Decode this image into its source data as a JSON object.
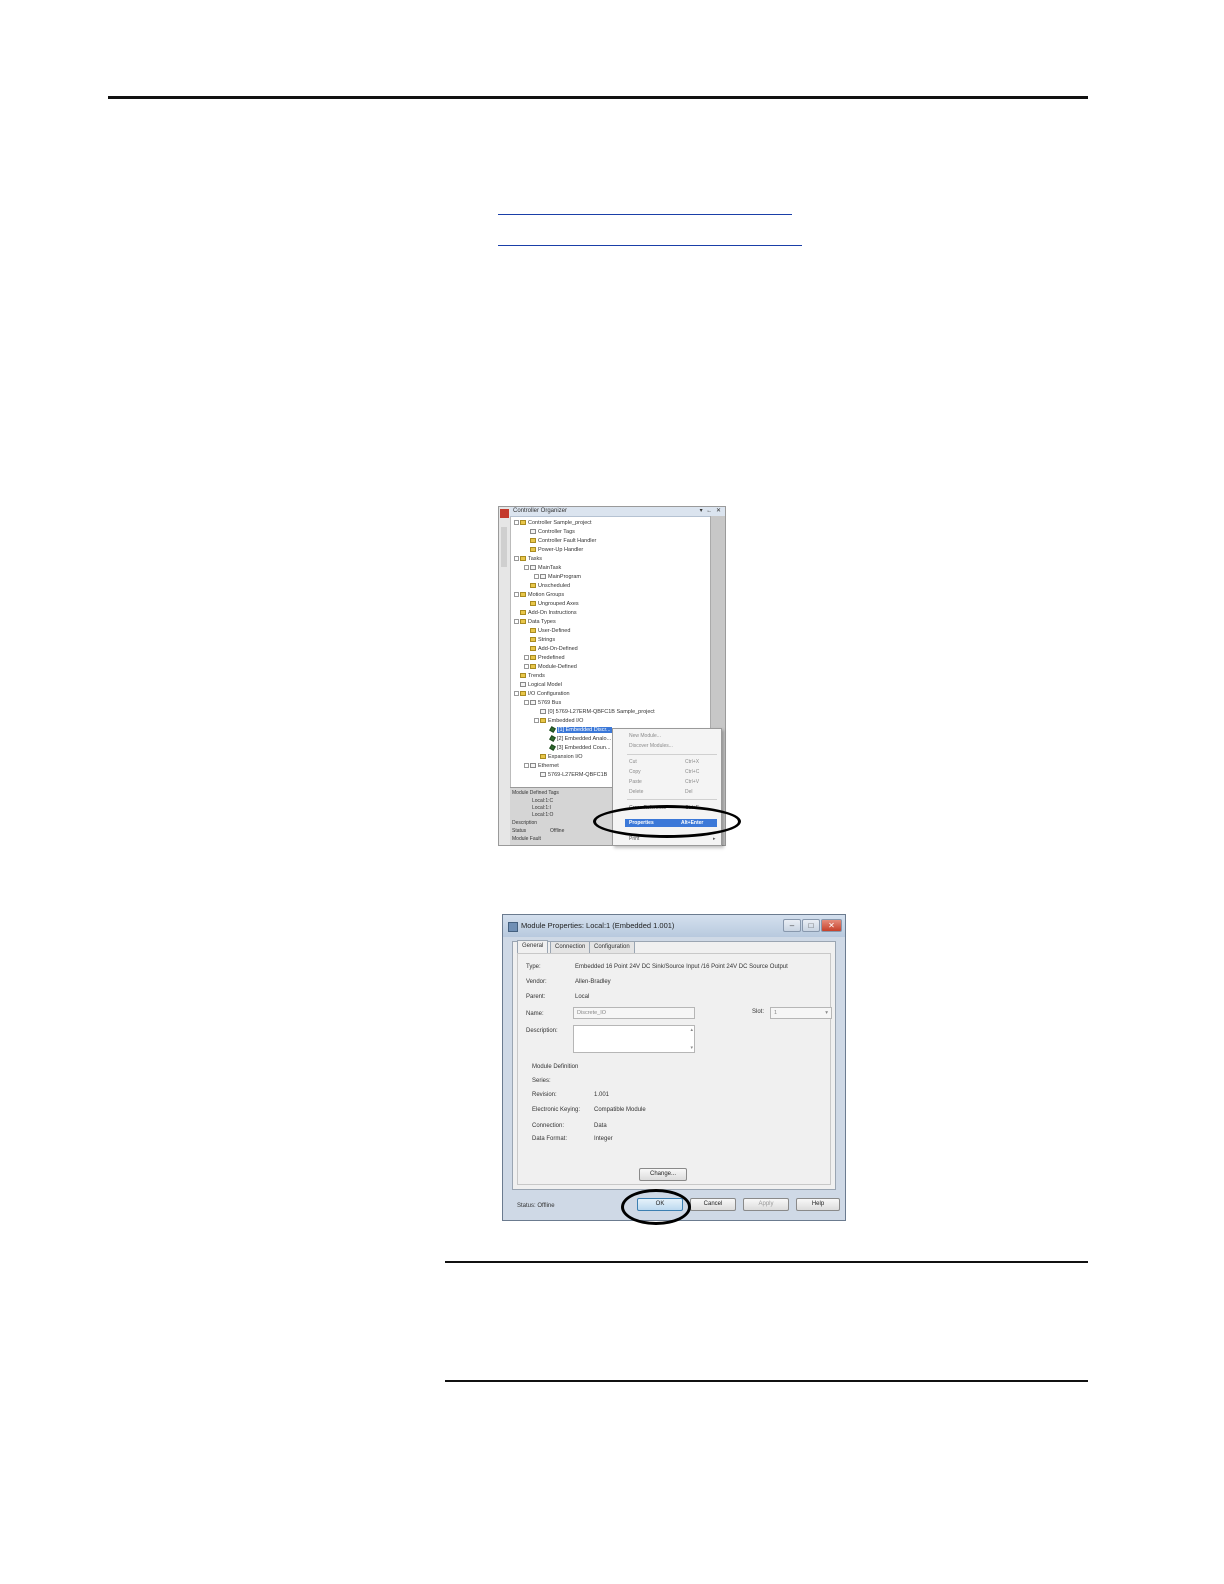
{
  "organizer": {
    "title": "Controller Organizer",
    "title_buttons": "▾ ← ✕",
    "tree": [
      {
        "label": "Controller Sample_project",
        "icon": "folder-icon",
        "expanded": true
      },
      {
        "label": "Controller Tags",
        "icon": "tags-icon"
      },
      {
        "label": "Controller Fault Handler",
        "icon": "folder-icon"
      },
      {
        "label": "Power-Up Handler",
        "icon": "folder-icon"
      },
      {
        "label": "Tasks",
        "icon": "folder-icon",
        "expanded": true
      },
      {
        "label": "MainTask",
        "icon": "task-icon",
        "expanded": true
      },
      {
        "label": "MainProgram",
        "icon": "program-icon"
      },
      {
        "label": "Unscheduled",
        "icon": "folder-icon"
      },
      {
        "label": "Motion Groups",
        "icon": "folder-icon",
        "expanded": true
      },
      {
        "label": "Ungrouped Axes",
        "icon": "folder-icon"
      },
      {
        "label": "Add-On Instructions",
        "icon": "folder-icon"
      },
      {
        "label": "Data Types",
        "icon": "folder-icon",
        "expanded": true
      },
      {
        "label": "User-Defined",
        "icon": "folder-icon"
      },
      {
        "label": "Strings",
        "icon": "folder-icon"
      },
      {
        "label": "Add-On-Defined",
        "icon": "folder-icon"
      },
      {
        "label": "Predefined",
        "icon": "folder-icon"
      },
      {
        "label": "Module-Defined",
        "icon": "folder-icon"
      },
      {
        "label": "Trends",
        "icon": "folder-icon"
      },
      {
        "label": "Logical Model",
        "icon": "model-icon"
      },
      {
        "label": "I/O Configuration",
        "icon": "folder-icon",
        "expanded": true
      },
      {
        "label": "5769 Bus",
        "icon": "bus-icon",
        "expanded": true
      },
      {
        "label": "[0] 5769-L27ERM-QBFC1B Sample_project",
        "icon": "controller-icon"
      },
      {
        "label": "Embedded I/O",
        "icon": "folder-icon",
        "expanded": true
      },
      {
        "label": "[1] Embedded Discr...",
        "icon": "module-icon",
        "selected": true
      },
      {
        "label": "[2] Embedded Analo...",
        "icon": "module-icon"
      },
      {
        "label": "[3] Embedded Coun...",
        "icon": "module-icon"
      },
      {
        "label": "Expansion I/O",
        "icon": "folder-icon"
      },
      {
        "label": "Ethernet",
        "icon": "network-icon",
        "expanded": true
      },
      {
        "label": "5769-L27ERM-QBFC1B",
        "icon": "controller-icon"
      }
    ],
    "bottom": {
      "header": "Module Defined Tags",
      "tags": [
        "Local:1:C",
        "Local:1:I",
        "Local:1:O"
      ],
      "description_label": "Description",
      "status_label": "Status",
      "status_value": "Offline",
      "module_fault_label": "Module Fault"
    }
  },
  "context_menu": {
    "items": [
      {
        "label": "New Module...",
        "shortcut": ""
      },
      {
        "label": "Discover Modules...",
        "shortcut": ""
      },
      {
        "label": "Cut",
        "shortcut": "Ctrl+X"
      },
      {
        "label": "Copy",
        "shortcut": "Ctrl+C"
      },
      {
        "label": "Paste",
        "shortcut": "Ctrl+V"
      },
      {
        "label": "Delete",
        "shortcut": "Del"
      },
      {
        "label": "Cross Reference",
        "shortcut": "Ctrl+E"
      },
      {
        "label": "Properties",
        "shortcut": "Alt+Enter"
      },
      {
        "label": "Print",
        "shortcut": "▸"
      }
    ]
  },
  "dialog": {
    "title": "Module Properties: Local:1 (Embedded 1.001)",
    "win_buttons": {
      "min": "–",
      "max": "□",
      "close": "✕"
    },
    "tabs": [
      "General",
      "Connection",
      "Configuration"
    ],
    "fields": {
      "type_label": "Type:",
      "type_value": "Embedded 16 Point 24V DC Sink/Source Input /16 Point 24V DC Source Output",
      "vendor_label": "Vendor:",
      "vendor_value": "Allen-Bradley",
      "parent_label": "Parent:",
      "parent_value": "Local",
      "name_label": "Name:",
      "name_value": "Discrete_IO",
      "slot_label": "Slot:",
      "slot_value": "1",
      "description_label": "Description:"
    },
    "module_definition": {
      "header": "Module Definition",
      "series_label": "Series:",
      "series_value": "",
      "revision_label": "Revision:",
      "revision_value": "1.001",
      "keying_label": "Electronic Keying:",
      "keying_value": "Compatible Module",
      "connection_label": "Connection:",
      "connection_value": "Data",
      "format_label": "Data Format:",
      "format_value": "Integer"
    },
    "change_button": "Change...",
    "status_label": "Status:",
    "status_value": "Offline",
    "buttons": {
      "ok": "OK",
      "cancel": "Cancel",
      "apply": "Apply",
      "help": "Help"
    }
  }
}
